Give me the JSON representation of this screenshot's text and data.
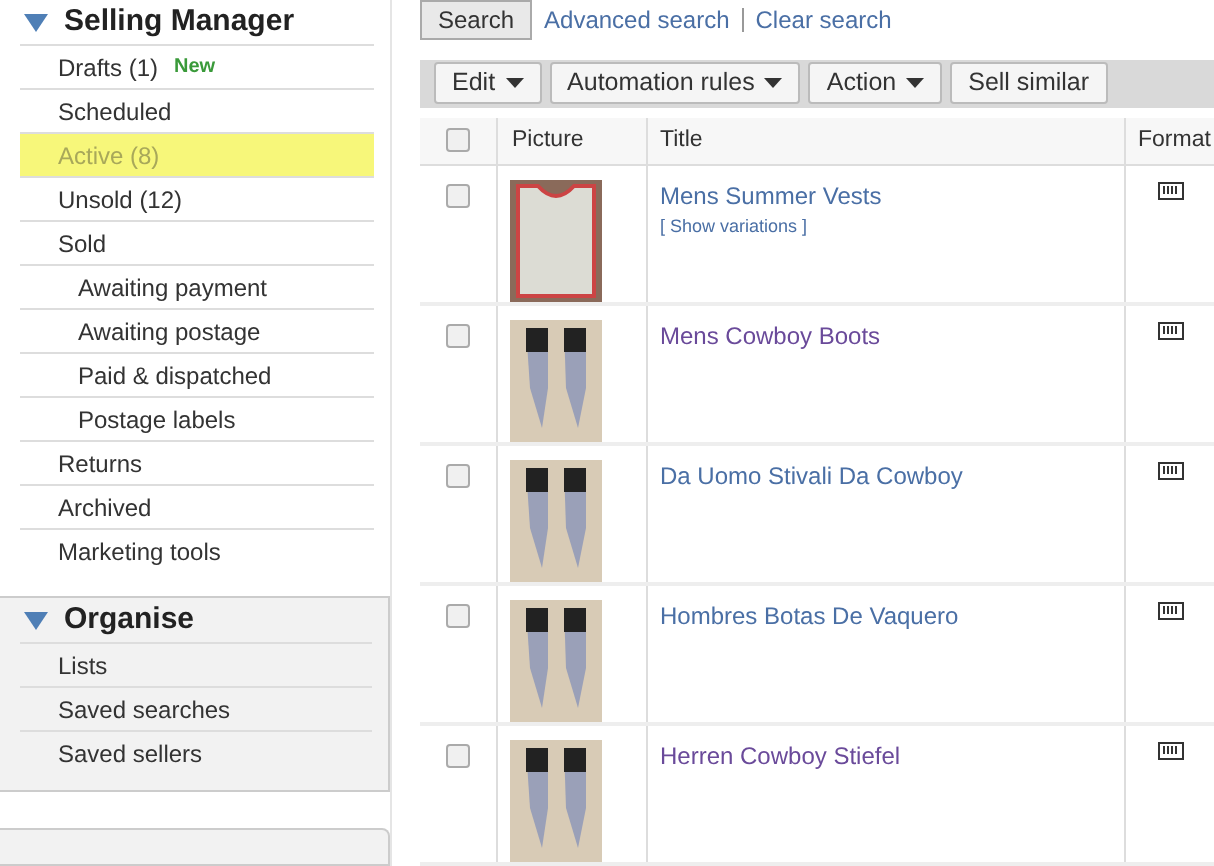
{
  "sidebar": {
    "sections": [
      {
        "title": "Selling Manager",
        "expanded": true,
        "items": [
          {
            "label": "Drafts (1)",
            "badge": "New",
            "selected": false
          },
          {
            "label": "Scheduled",
            "selected": false
          },
          {
            "label": "Active (8)",
            "selected": true
          },
          {
            "label": "Unsold (12)",
            "selected": false
          },
          {
            "label": "Sold",
            "selected": false,
            "children": [
              {
                "label": "Awaiting payment",
                "selected": false
              },
              {
                "label": "Awaiting postage",
                "selected": false
              },
              {
                "label": "Paid & dispatched",
                "selected": false
              },
              {
                "label": "Postage labels",
                "selected": false
              }
            ]
          },
          {
            "label": "Returns",
            "selected": false
          },
          {
            "label": "Archived",
            "selected": false
          },
          {
            "label": "Marketing tools",
            "selected": false
          }
        ]
      },
      {
        "title": "Organise",
        "expanded": true,
        "items": [
          {
            "label": "Lists",
            "selected": false
          },
          {
            "label": "Saved searches",
            "selected": false
          },
          {
            "label": "Saved sellers",
            "selected": false
          }
        ]
      }
    ]
  },
  "search": {
    "button": "Search",
    "links": [
      "Advanced search",
      "Clear search"
    ]
  },
  "toolbar": [
    {
      "label": "Edit",
      "dropdown": true
    },
    {
      "label": "Automation rules",
      "dropdown": true
    },
    {
      "label": "Action",
      "dropdown": true
    },
    {
      "label": "Sell similar",
      "dropdown": false
    }
  ],
  "table": {
    "columns": [
      "Picture",
      "Title",
      "Format"
    ],
    "select_all_checked": false,
    "rows": [
      {
        "title": "Mens Summer Vests",
        "sub_link": "[ Show variations ]",
        "visited": false,
        "checked": false,
        "kind": "vest"
      },
      {
        "title": "Mens Cowboy Boots",
        "visited": true,
        "checked": false,
        "kind": "boots"
      },
      {
        "title": "Da Uomo Stivali Da Cowboy",
        "visited": false,
        "checked": false,
        "kind": "boots"
      },
      {
        "title": "Hombres Botas De Vaquero",
        "visited": false,
        "checked": false,
        "kind": "boots"
      },
      {
        "title": "Herren Cowboy Stiefel",
        "visited": true,
        "checked": false,
        "kind": "boots"
      }
    ]
  }
}
